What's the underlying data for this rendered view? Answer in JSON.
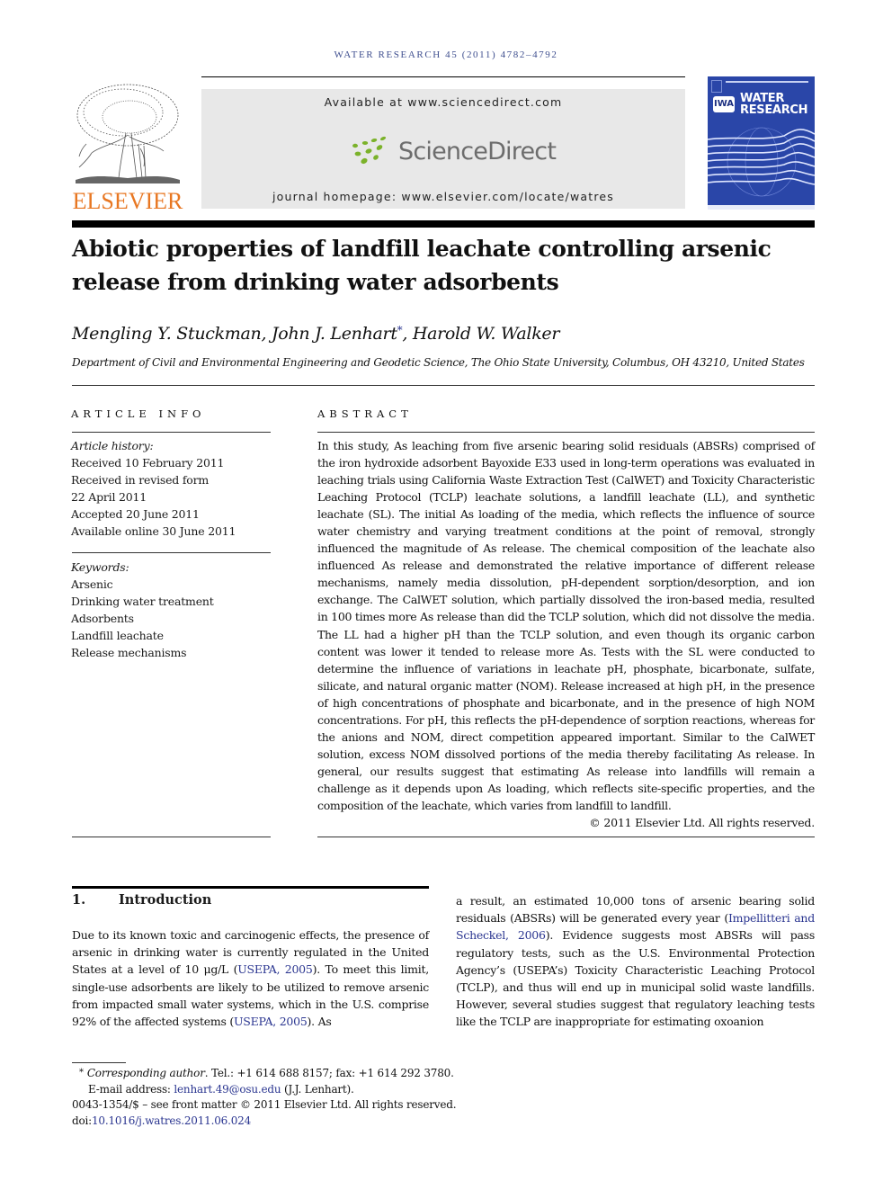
{
  "running_head": "WATER RESEARCH 45 (2011) 4782–4792",
  "header": {
    "publisher_logo_text": "ELSEVIER",
    "available_at": "Available at www.sciencedirect.com",
    "sciencedirect_logo_text": "ScienceDirect",
    "journal_homepage": "journal homepage: www.elsevier.com/locate/watres",
    "cover": {
      "badge": "IWA",
      "title_line1": "WATER",
      "title_line2": "RESEARCH"
    },
    "colors": {
      "elsevier_orange": "#e87722",
      "sciencedirect_green": "#7bb22a",
      "sciencedirect_gray": "#6d6d6d",
      "cover_blue": "#2a46a8",
      "link_blue": "#2a3590",
      "running_head_blue": "#3f4f8f"
    }
  },
  "article": {
    "title_line1": "Abiotic properties of landfill leachate controlling arsenic",
    "title_line2": "release from drinking water adsorbents",
    "authors": [
      {
        "name": "Mengling Y. Stuckman",
        "corresponding": false
      },
      {
        "name": "John J. Lenhart",
        "corresponding": true
      },
      {
        "name": "Harold W. Walker",
        "corresponding": false
      }
    ],
    "author_separator": ", ",
    "corresponding_mark": "*",
    "affiliation": "Department of Civil and Environmental Engineering and Geodetic Science, The Ohio State University, Columbus, OH 43210, United States"
  },
  "article_info": {
    "heading": "ARTICLE INFO",
    "history_label": "Article history:",
    "history": [
      "Received 10 February 2011",
      "Received in revised form",
      "22 April 2011",
      "Accepted 20 June 2011",
      "Available online 30 June 2011"
    ],
    "keywords_label": "Keywords:",
    "keywords": [
      "Arsenic",
      "Drinking water treatment",
      "Adsorbents",
      "Landfill leachate",
      "Release mechanisms"
    ]
  },
  "abstract": {
    "heading": "ABSTRACT",
    "text": "In this study, As leaching from five arsenic bearing solid residuals (ABSRs) comprised of the iron hydroxide adsorbent Bayoxide E33 used in long-term operations was evaluated in leaching trials using California Waste Extraction Test (CalWET) and Toxicity Characteristic Leaching Protocol (TCLP) leachate solutions, a landfill leachate (LL), and synthetic leachate (SL). The initial As loading of the media, which reflects the influence of source water chemistry and varying treatment conditions at the point of removal, strongly influenced the magnitude of As release. The chemical composition of the leachate also influenced As release and demonstrated the relative importance of different release mechanisms, namely media dissolution, pH-dependent sorption/desorption, and ion exchange. The CalWET solution, which partially dissolved the iron-based media, resulted in 100 times more As release than did the TCLP solution, which did not dissolve the media. The LL had a higher pH than the TCLP solution, and even though its organic carbon content was lower it tended to release more As. Tests with the SL were conducted to determine the influence of variations in leachate pH, phosphate, bicarbonate, sulfate, silicate, and natural organic matter (NOM). Release increased at high pH, in the presence of high concentrations of phosphate and bicarbonate, and in the presence of high NOM concentrations. For pH, this reflects the pH-dependence of sorption reactions, whereas for the anions and NOM, direct competition appeared important. Similar to the CalWET solution, excess NOM dissolved portions of the media thereby facilitating As release. In general, our results suggest that estimating As release into landfills will remain a challenge as it depends upon As loading, which reflects site-specific properties, and the composition of the leachate, which varies from landfill to landfill.",
    "copyright": "© 2011 Elsevier Ltd. All rights reserved."
  },
  "introduction": {
    "number": "1.",
    "heading": "Introduction",
    "left_column": [
      {
        "t": "Due to its known toxic and carcinogenic effects, the presence of arsenic in drinking water is currently regulated in the United States at a level of 10 μg/L ("
      },
      {
        "link": "USEPA, 2005"
      },
      {
        "t": "). To meet this limit, single-use adsorbents are likely to be utilized to remove arsenic from impacted small water systems, which in the U.S. comprise 92% of the affected systems ("
      },
      {
        "link": "USEPA, 2005"
      },
      {
        "t": "). As"
      }
    ],
    "right_column": [
      {
        "t": "a result, an estimated 10,000 tons of arsenic bearing solid residuals (ABSRs) will be generated every year ("
      },
      {
        "link": "Impellitteri and Scheckel, 2006"
      },
      {
        "t": "). Evidence suggests most ABSRs will pass regulatory tests, such as the U.S. Environmental Protection Agency’s (USEPA’s) Toxicity Characteristic Leaching Protocol (TCLP), and thus will end up in municipal solid waste landfills. However, several studies suggest that regulatory leaching tests like the TCLP are inappropriate for estimating oxoanion"
      }
    ]
  },
  "footnotes": {
    "star": "*",
    "corresponding_label": "Corresponding author",
    "contact": ". Tel.: +1 614 688 8157; fax: +1 614 292 3780.",
    "email_label": "E-mail address: ",
    "email": "lenhart.49@osu.edu",
    "email_suffix": " (J.J. Lenhart).",
    "issn_line": "0043-1354/$ – see front matter © 2011 Elsevier Ltd. All rights reserved.",
    "doi_label": "doi:",
    "doi": "10.1016/j.watres.2011.06.024"
  }
}
